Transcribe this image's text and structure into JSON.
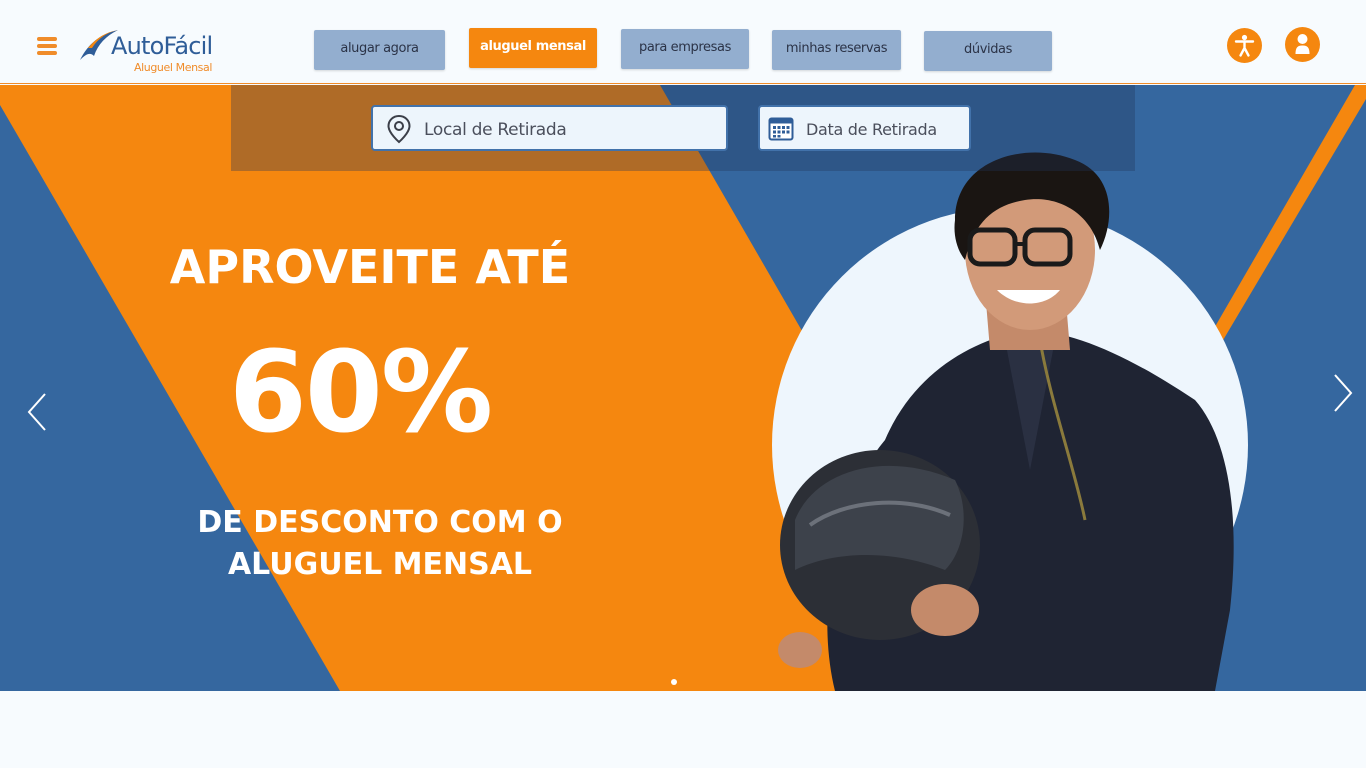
{
  "brand": {
    "name": "AutoFácil",
    "tagline": "Aluguel Mensal",
    "colors": {
      "orange": "#f5870f",
      "blue": "#35679f",
      "navy": "#2f5d98",
      "nav_button": "#93aecf"
    }
  },
  "header": {
    "menu_icon": "hamburger-icon",
    "nav": [
      {
        "label": "alugar agora",
        "active": false
      },
      {
        "label": "aluguel mensal",
        "active": true
      },
      {
        "label": "para empresas",
        "active": false
      },
      {
        "label": "minhas reservas",
        "active": false
      },
      {
        "label": "dúvidas",
        "active": false
      }
    ],
    "icons": {
      "accessibility": "accessibility-icon",
      "user": "user-icon"
    }
  },
  "search": {
    "pickup_location": {
      "placeholder": "Local de Retirada",
      "value": "",
      "icon": "map-pin-icon"
    },
    "pickup_date": {
      "placeholder": "Data de Retirada",
      "value": "",
      "icon": "calendar-icon"
    }
  },
  "hero": {
    "line1": "APROVEITE ATÉ",
    "discount": "60%",
    "line3a": "DE DESCONTO COM O",
    "line3b": "ALUGUEL MENSAL",
    "image": "smiling-man-holding-motorcycle-helmet",
    "carousel": {
      "prev_icon": "chevron-left-icon",
      "next_icon": "chevron-right-icon",
      "current_slide": 1,
      "total_slides": 1
    }
  }
}
